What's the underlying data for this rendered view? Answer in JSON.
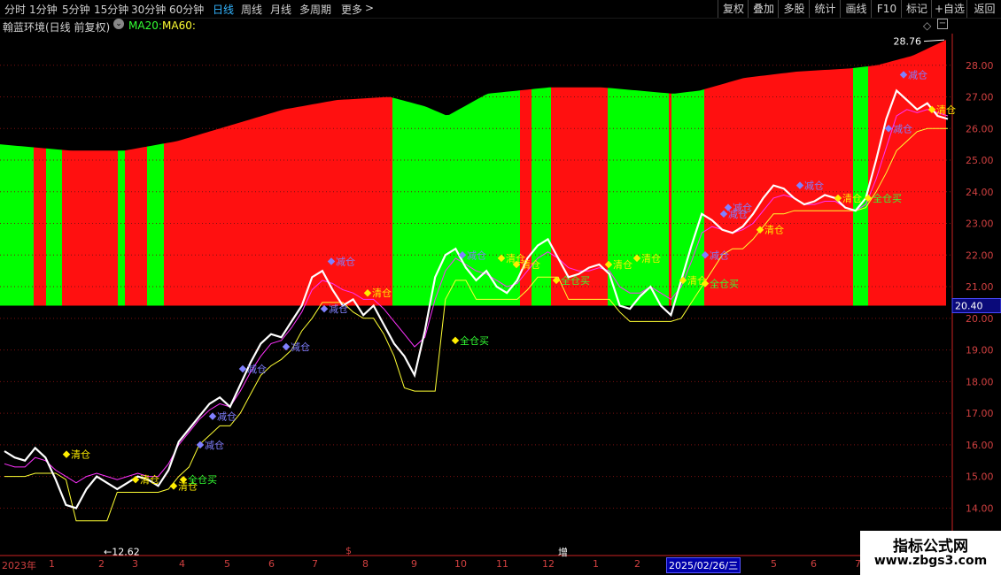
{
  "toolbar": {
    "periods": [
      {
        "label": "分时",
        "active": false
      },
      {
        "label": "1分钟",
        "active": false
      },
      {
        "label": "5分钟",
        "active": false
      },
      {
        "label": "15分钟",
        "active": false
      },
      {
        "label": "30分钟",
        "active": false
      },
      {
        "label": "60分钟",
        "active": false
      },
      {
        "label": "日线",
        "active": true
      },
      {
        "label": "周线",
        "active": false
      },
      {
        "label": "月线",
        "active": false
      },
      {
        "label": "多周期",
        "active": false
      },
      {
        "label": "更多",
        "active": false
      }
    ],
    "more_arrow": ">",
    "right_buttons": [
      "复权",
      "叠加",
      "多股",
      "统计",
      "画线",
      "F10",
      "标记",
      "+自选",
      "返回"
    ]
  },
  "title": {
    "indicator_name": "翰蓝环境(日线 前复权)",
    "ma20": "MA20:",
    "ma60": "MA60:",
    "dropdown_icon": "chevron-down-circle-icon"
  },
  "colors": {
    "red_band": "#ff1010",
    "green_band": "#00ff00",
    "white_line": "#ffffff",
    "magenta_line": "#ff33ff",
    "yellow_line": "#ffff33",
    "axis": "#cc2222",
    "sell_marker": "#8080ff",
    "buy_marker": "#ffee00",
    "buy_text": "#33ff33"
  },
  "chart_data": {
    "type": "line",
    "ylim": [
      12.5,
      29.0
    ],
    "y_ticks": [
      "28.00",
      "27.00",
      "26.00",
      "25.00",
      "24.00",
      "23.00",
      "22.00",
      "21.00",
      "20.00",
      "19.00",
      "18.00",
      "17.00",
      "16.00",
      "15.00",
      "14.00"
    ],
    "current_price_label": "20.40",
    "high_label": "28.76",
    "low_label": "12.62",
    "x_labels": [
      "2023年",
      "1",
      "2",
      "3",
      "4",
      "5",
      "6",
      "7",
      "8",
      "9",
      "10",
      "11",
      "12",
      "1",
      "2",
      "2025/02/26/三",
      "5",
      "6",
      "7"
    ],
    "marks": [
      "$",
      "增"
    ],
    "series": [
      {
        "values": [
          15.8,
          15.6,
          15.5,
          15.9,
          15.6,
          14.9,
          14.1,
          14.0,
          14.6,
          15.0,
          14.8,
          14.6,
          14.8,
          15.0,
          14.9,
          14.7,
          15.2,
          16.1,
          16.5,
          16.9,
          17.3,
          17.5,
          17.2,
          17.9,
          18.6,
          19.2,
          19.5,
          19.4,
          19.9,
          20.4,
          21.3,
          21.5,
          20.9,
          20.4,
          20.6,
          20.1,
          20.4,
          19.8,
          19.2,
          18.8,
          18.2,
          19.6,
          21.3,
          22.0,
          22.2,
          21.6,
          21.2,
          21.5,
          21.0,
          20.8,
          21.2,
          21.9,
          22.3,
          22.5,
          21.9,
          21.3,
          21.4,
          21.6,
          21.7,
          21.4,
          20.4,
          20.3,
          20.7,
          21.0,
          20.4,
          20.1,
          21.2,
          22.3,
          23.3,
          23.1,
          22.8,
          22.7,
          22.9,
          23.3,
          23.8,
          24.2,
          24.1,
          23.8,
          23.6,
          23.7,
          23.9,
          23.8,
          23.5,
          23.4,
          23.8,
          25.0,
          26.3,
          27.2,
          26.9,
          26.6,
          26.8,
          26.4,
          26.3
        ]
      },
      {
        "values": [
          15.4,
          15.3,
          15.3,
          15.6,
          15.5,
          15.2,
          15.0,
          14.8,
          15.0,
          15.1,
          15.0,
          14.9,
          15.0,
          15.1,
          15.0,
          15.0,
          15.4,
          16.0,
          16.4,
          16.8,
          17.1,
          17.3,
          17.2,
          17.7,
          18.3,
          18.8,
          19.2,
          19.3,
          19.7,
          20.2,
          20.9,
          21.2,
          21.1,
          20.9,
          20.8,
          20.6,
          20.6,
          20.3,
          19.9,
          19.5,
          19.1,
          19.4,
          20.6,
          21.5,
          21.9,
          21.7,
          21.5,
          21.4,
          21.2,
          21.0,
          21.1,
          21.5,
          21.9,
          22.1,
          21.9,
          21.6,
          21.5,
          21.5,
          21.6,
          21.5,
          21.0,
          20.8,
          20.8,
          21.0,
          20.8,
          20.6,
          21.0,
          21.8,
          22.7,
          22.9,
          22.8,
          22.7,
          22.8,
          23.0,
          23.4,
          23.8,
          23.9,
          23.8,
          23.6,
          23.6,
          23.7,
          23.7,
          23.5,
          23.4,
          23.6,
          24.4,
          25.4,
          26.4,
          26.6,
          26.5,
          26.6,
          26.5,
          26.4
        ]
      },
      {
        "values": [
          15.0,
          15.0,
          15.0,
          15.1,
          15.1,
          15.1,
          14.9,
          13.6,
          13.6,
          13.6,
          13.6,
          14.5,
          14.5,
          14.5,
          14.5,
          14.5,
          14.6,
          15.0,
          15.3,
          16.0,
          16.3,
          16.6,
          16.6,
          17.0,
          17.6,
          18.2,
          18.5,
          18.7,
          19.0,
          19.6,
          20.0,
          20.5,
          20.5,
          20.5,
          20.2,
          20.0,
          20.0,
          19.5,
          18.8,
          17.8,
          17.7,
          17.7,
          17.7,
          20.6,
          21.2,
          21.2,
          20.6,
          20.6,
          20.6,
          20.6,
          20.6,
          20.9,
          21.3,
          21.3,
          21.3,
          20.6,
          20.6,
          20.6,
          20.6,
          20.6,
          20.2,
          19.9,
          19.9,
          19.9,
          19.9,
          19.9,
          20.0,
          20.5,
          21.0,
          21.5,
          22.0,
          22.2,
          22.2,
          22.5,
          22.9,
          23.3,
          23.3,
          23.4,
          23.4,
          23.4,
          23.4,
          23.4,
          23.4,
          23.4,
          23.5,
          24.0,
          24.6,
          25.3,
          25.6,
          25.9,
          26.0,
          26.0,
          26.0
        ]
      }
    ],
    "signals": [
      {
        "label": "全仓买",
        "kind": "buy-all"
      },
      {
        "label": "清仓",
        "kind": "clear"
      },
      {
        "label": "减仓",
        "kind": "reduce"
      }
    ]
  },
  "watermark": {
    "line1": "指标公式网",
    "line2": "www.zbgs3.com"
  }
}
